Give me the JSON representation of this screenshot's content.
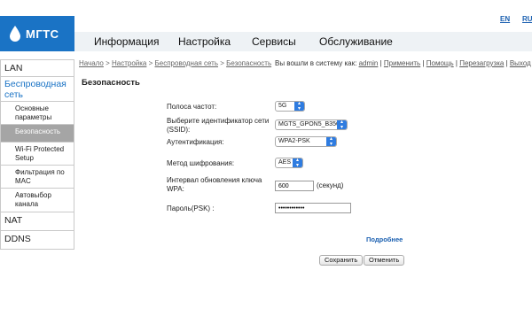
{
  "brand": {
    "name": "МГТС",
    "color": "#1a73c5"
  },
  "languages": [
    "EN",
    "RU"
  ],
  "topnav": [
    "Информация",
    "Настройка",
    "Сервисы",
    "Обслуживание"
  ],
  "sidebar": {
    "lan": "LAN",
    "wireless": "Беспроводная сеть",
    "sub": [
      "Основные параметры",
      "Безопасность",
      "Wi-Fi Protected Setup",
      "Фильтрация по MAC",
      "Автовыбор канала"
    ],
    "nat": "NAT",
    "ddns": "DDNS"
  },
  "breadcrumb": [
    "Начало",
    "Настройка",
    "Беспроводная сеть",
    "Безопасность"
  ],
  "status": {
    "prefix": "Вы вошли в систему как:",
    "user": "admin",
    "links": [
      "Применить",
      "Помощь",
      "Перезагрузка",
      "Выход"
    ]
  },
  "page_title": "Безопасность",
  "form": {
    "band_label": "Полоса частот:",
    "band_value": "5G",
    "ssid_label": "Выберите идентификатор сети (SSID):",
    "ssid_value": "MGTS_GPON5_B356",
    "auth_label": "Аутентификация:",
    "auth_value": "WPA2-PSK",
    "cipher_label": "Метод шифрования:",
    "cipher_value": "AES",
    "interval_label": "Интервал обновления ключа WPA:",
    "interval_value": "600",
    "interval_unit": "(секунд)",
    "psk_label": "Пароль(PSK) :",
    "psk_value": "••••••••••••"
  },
  "more_link": "Подробнее",
  "buttons": {
    "save": "Сохранить",
    "cancel": "Отменить"
  }
}
